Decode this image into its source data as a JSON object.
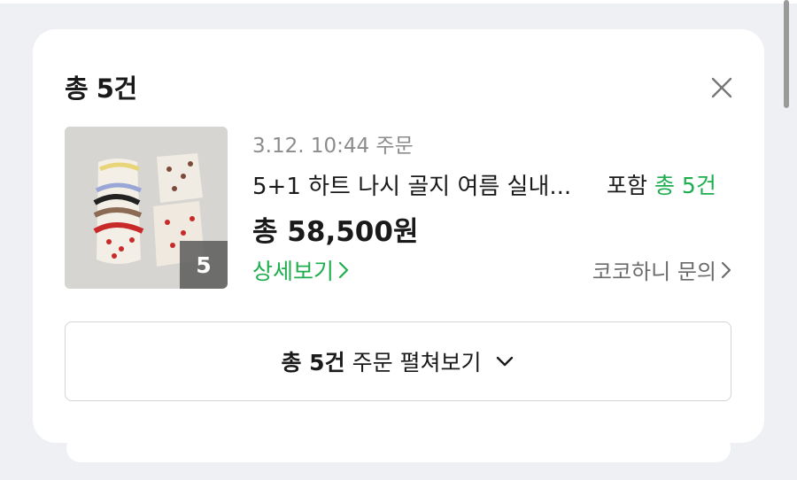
{
  "sheet": {
    "title": "총 5건",
    "close_icon": "close-icon"
  },
  "order": {
    "image_count": "5",
    "date_text": "3.12. 10:44 주문",
    "product_name": "5+1 하트 나시 골지 여름 실내...",
    "included_prefix": "포함",
    "included_count": "총 5건",
    "total_price": "총 58,500원",
    "detail_link": "상세보기",
    "inquiry_link": "코코하니 문의"
  },
  "expand_button": {
    "strong": "총 5건",
    "rest": "주문 펼쳐보기",
    "icon": "chevron-down-icon"
  },
  "colors": {
    "accent_green": "#1fae4f",
    "page_bg": "#eef0f3"
  }
}
